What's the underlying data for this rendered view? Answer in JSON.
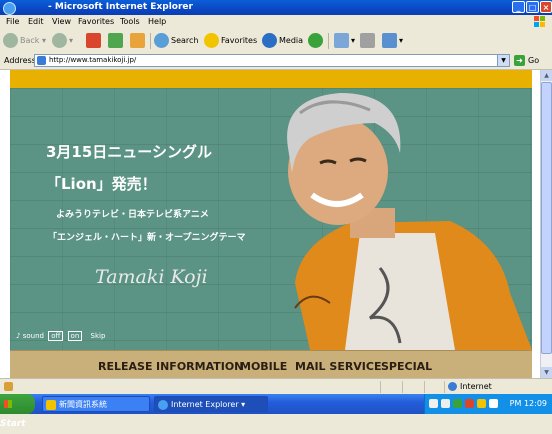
{
  "window": {
    "title": "- Microsoft Internet Explorer",
    "controls": [
      "minimize",
      "maximize",
      "close"
    ]
  },
  "menu": [
    "File",
    "Edit",
    "View",
    "Favorites",
    "Tools",
    "Help"
  ],
  "toolbar": {
    "back": "Back",
    "search": "Search",
    "favorites": "Favorites",
    "media": "Media"
  },
  "address": {
    "label": "Address",
    "url": "http://www.tamakikoji.jp/",
    "go": "Go"
  },
  "site": {
    "headline_line1": "3月15日ニューシングル",
    "headline_line2": "「Lion」発売！",
    "sub_line1": "よみうりテレビ・日本テレビ系アニメ",
    "sub_line2": "「エンジェル・ハート」新・オープニングテーマ",
    "signature": "Tamaki Koji",
    "sound_label": "sound",
    "sound_off": "off",
    "sound_on": "on",
    "skip": "Skip",
    "nav": [
      "RELEASE",
      "INFORMATION",
      "MOBILE",
      "MAIL SERVICE",
      "SPECIAL"
    ],
    "colors": {
      "accent_bar": "#e8b000",
      "wall": "#5b9384",
      "nav_bg": "#c9b07a"
    }
  },
  "status": {
    "zone": "Internet"
  },
  "taskbar": {
    "start": "Start",
    "tasks": [
      "新聞資訊系統",
      "Internet Explorer"
    ],
    "clock": "PM 12:09"
  }
}
